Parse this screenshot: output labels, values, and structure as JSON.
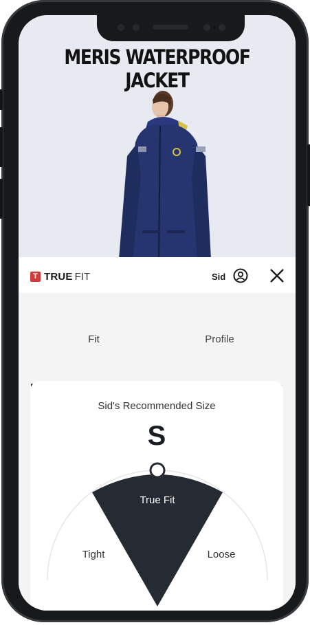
{
  "product": {
    "title": "MERIS WATERPROOF JACKET",
    "image_alt": "Model wearing navy waterproof jacket"
  },
  "brand": {
    "badge": "T",
    "name_bold": "TRUE",
    "name_light": "FIT"
  },
  "user": {
    "name": "Sid",
    "icon": "user-circle-icon"
  },
  "close": {
    "icon": "close-icon"
  },
  "tabs": [
    {
      "label": "Fit",
      "active": true
    },
    {
      "label": "Profile",
      "active": false
    }
  ],
  "recommendation": {
    "title": "Sid's Recommended Size",
    "size": "S"
  },
  "gauge": {
    "center_label": "True Fit",
    "left_label": "Tight",
    "right_label": "Loose",
    "position": 0.5
  },
  "colors": {
    "accent_dark": "#2b2f36",
    "brand_red": "#d23b3b",
    "jacket_navy": "#26346f"
  }
}
